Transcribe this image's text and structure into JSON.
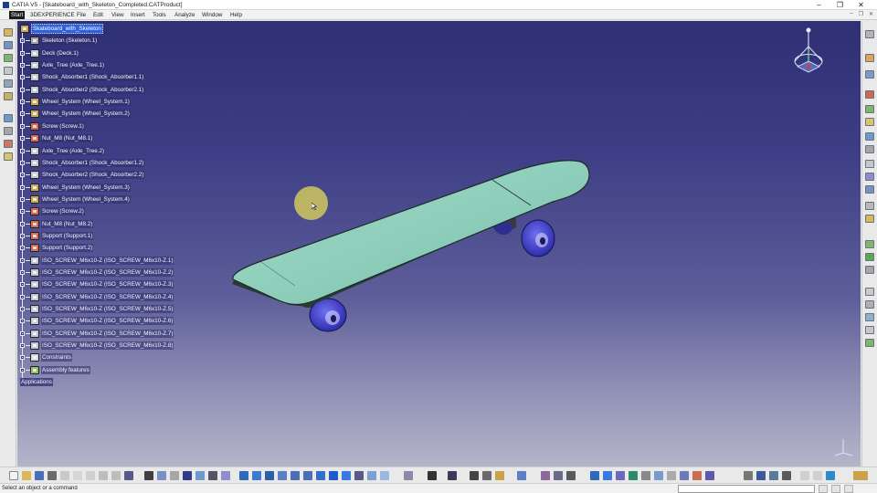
{
  "window": {
    "title": "CATIA V5 - [Skateboard_with_Skeleton_Completed.CATProduct]",
    "controls": [
      "–",
      "❐",
      "✕"
    ],
    "mdi_controls": [
      "–",
      "❐",
      "✕"
    ]
  },
  "menubar": {
    "items": [
      "Start",
      "3DEXPERIENCE",
      "File",
      "Edit",
      "View",
      "Insert",
      "Tools",
      "Analyze",
      "Window",
      "Help"
    ],
    "active": "Start"
  },
  "tree": {
    "root": "Skateboard_with_Skeleton",
    "items": [
      {
        "label": "Skeleton (Skeleton.1)",
        "icon": "skeleton-part-icon"
      },
      {
        "label": "Deck (Deck.1)",
        "icon": "part-icon"
      },
      {
        "label": "Axle_Tree (Axle_Tree.1)",
        "icon": "part-icon"
      },
      {
        "label": "Shock_Absorber1 (Shock_Absorber1.1)",
        "icon": "part-icon"
      },
      {
        "label": "Shock_Absorber2 (Shock_Absorber2.1)",
        "icon": "part-icon"
      },
      {
        "label": "Wheel_System (Wheel_System.1)",
        "icon": "assembly-icon"
      },
      {
        "label": "Wheel_System (Wheel_System.2)",
        "icon": "assembly-icon"
      },
      {
        "label": "Screw (Screw.1)",
        "icon": "screw-icon"
      },
      {
        "label": "Nut_M8 (Nut_M8.1)",
        "icon": "screw-icon"
      },
      {
        "label": "Axle_Tree (Axle_Tree.2)",
        "icon": "part-icon"
      },
      {
        "label": "Shock_Absorber1 (Shock_Absorber1.2)",
        "icon": "part-icon"
      },
      {
        "label": "Shock_Absorber2 (Shock_Absorber2.2)",
        "icon": "part-icon"
      },
      {
        "label": "Wheel_System (Wheel_System.3)",
        "icon": "assembly-icon"
      },
      {
        "label": "Wheel_System (Wheel_System.4)",
        "icon": "assembly-icon"
      },
      {
        "label": "Screw (Screw.2)",
        "icon": "screw-icon"
      },
      {
        "label": "Nut_M8 (Nut_M8.2)",
        "icon": "screw-icon"
      },
      {
        "label": "Support (Support.1)",
        "icon": "screw-icon"
      },
      {
        "label": "Support (Support.2)",
        "icon": "screw-icon"
      },
      {
        "label": "ISO_SCREW_M6x10-Z (ISO_SCREW_M6x10-Z.1)",
        "icon": "part-icon"
      },
      {
        "label": "ISO_SCREW_M6x10-Z (ISO_SCREW_M6x10-Z.2)",
        "icon": "part-icon"
      },
      {
        "label": "ISO_SCREW_M6x10-Z (ISO_SCREW_M6x10-Z.3)",
        "icon": "part-icon"
      },
      {
        "label": "ISO_SCREW_M6x10-Z (ISO_SCREW_M6x10-Z.4)",
        "icon": "part-icon"
      },
      {
        "label": "ISO_SCREW_M6x10-Z (ISO_SCREW_M6x10-Z.5)",
        "icon": "part-icon"
      },
      {
        "label": "ISO_SCREW_M6x10-Z (ISO_SCREW_M6x10-Z.6)",
        "icon": "part-icon"
      },
      {
        "label": "ISO_SCREW_M6x10-Z (ISO_SCREW_M6x10-Z.7)",
        "icon": "part-icon"
      },
      {
        "label": "ISO_SCREW_M6x10-Z (ISO_SCREW_M6x10-Z.8)",
        "icon": "part-icon"
      },
      {
        "label": "Constraints",
        "icon": "constraints-icon"
      },
      {
        "label": "Assembly features",
        "icon": "assembly-features-icon"
      }
    ],
    "applications": "Applications"
  },
  "statusbar": {
    "message": "Select an object or a command",
    "command_value": ""
  },
  "colors": {
    "deck": "#8fd0bd",
    "wheel": "#4a4ad8",
    "viewport_top": "#2f2f74",
    "viewport_bottom": "#b5b5c9",
    "selection": "#2f62d9"
  }
}
